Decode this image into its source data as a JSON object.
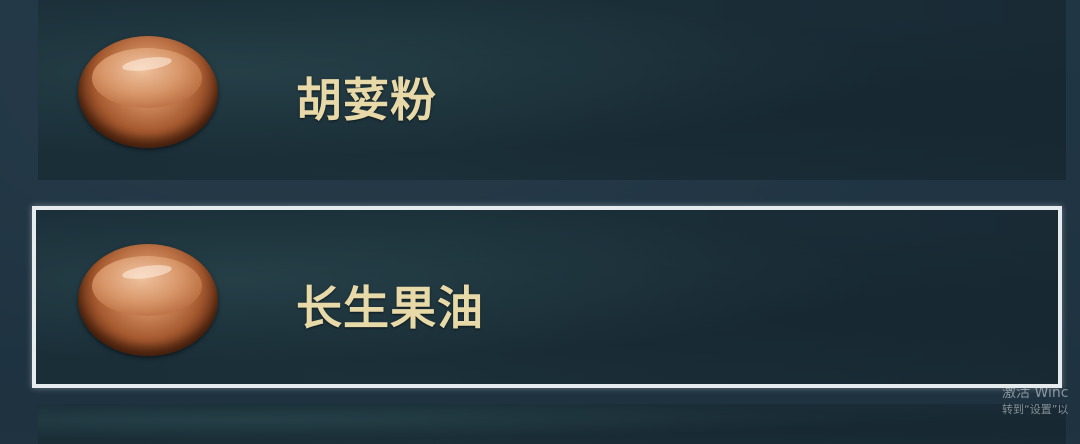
{
  "items": [
    {
      "label": "胡荽粉",
      "icon": "sauce-bowl-icon",
      "selected": false
    },
    {
      "label": "长生果油",
      "icon": "sauce-bowl-icon",
      "selected": true
    }
  ],
  "watermark": {
    "line1": "激活 Winc",
    "line2": "转到“设置”以"
  },
  "colors": {
    "label": "#e7d9a8",
    "selection_border": "#e6ebee",
    "background": "#1f3341"
  }
}
